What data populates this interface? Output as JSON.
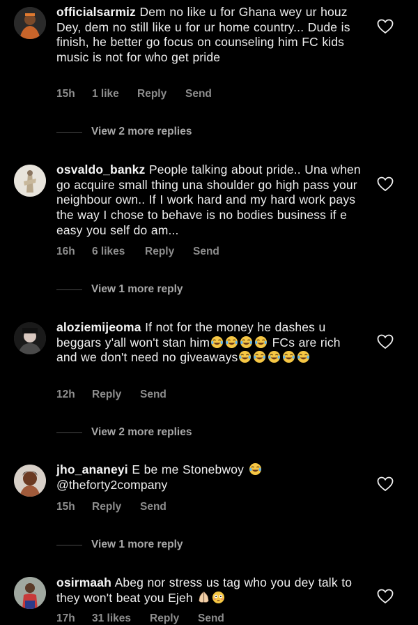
{
  "comments": [
    {
      "username": "officialsarmiz",
      "text": "Dem no like u for Ghana wey ur houz Dey, dem no still like u for ur home country... Dude is finish, he better go focus on counseling him FC kids music is not for who get pride",
      "time": "15h",
      "likes": "1 like",
      "reply": "Reply",
      "send": "Send",
      "view_replies": "View 2 more replies",
      "avatar_color": "#c8642a"
    },
    {
      "username": "osvaldo_bankz",
      "text": "People talking about pride.. Una when go acquire small thing una shoulder go high pass your neighbour own.. If I work hard and my hard work pays the way I chose to behave is no bodies business if e easy you self do am...",
      "time": "16h",
      "likes": "6 likes",
      "reply": "Reply",
      "send": "Send",
      "view_replies": "View 1 more reply",
      "avatar_color": "#d9d2c4"
    },
    {
      "username": "aloziemijeoma",
      "text_a": "If not for the money he dashes u beggars y'all won't stan him",
      "text_b": " FCs are rich and we don't need no giveaways",
      "emoji_face": "face-with-tears-of-joy-icon",
      "time": "12h",
      "reply": "Reply",
      "send": "Send",
      "view_replies": "View 2 more replies",
      "avatar_color": "#3a3a3a"
    },
    {
      "username": "jho_ananeyi",
      "text_a": "E be me Stonebwoy",
      "text_b": "@theforty2company",
      "time": "15h",
      "reply": "Reply",
      "send": "Send",
      "view_replies": "View 1 more reply",
      "avatar_color": "#6b3a22"
    },
    {
      "username": "osirmaah",
      "text": "Abeg nor stress us tag who you dey talk to they won't beat you Ejeh",
      "emoji_a": "folded-hands-icon",
      "emoji_b": "flushed-face-icon",
      "time": "17h",
      "likes": "31 likes",
      "reply": "Reply",
      "send": "Send",
      "avatar_color": "#5a4a3a"
    }
  ],
  "icons": {
    "like": "heart-outline-icon"
  },
  "colors": {
    "background": "#000000",
    "meta_text": "#8e8e8e",
    "emoji_yellow": "#f6c744"
  }
}
